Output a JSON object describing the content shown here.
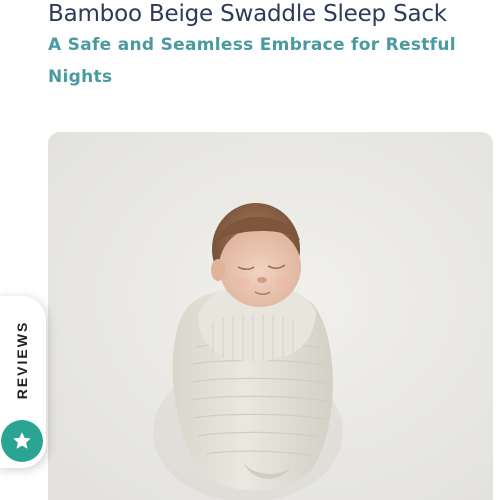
{
  "product": {
    "title": "Bamboo Beige Swaddle Sleep Sack",
    "subtitle": "A Safe and Seamless Embrace for Restful Nights"
  },
  "reviews_tab": {
    "label": "REVIEWS",
    "icon": "star-icon"
  },
  "colors": {
    "title": "#2e3a59",
    "subtitle": "#4a9ba0",
    "reviews_badge": "#2ba593",
    "image_background": "#ebeae6"
  }
}
